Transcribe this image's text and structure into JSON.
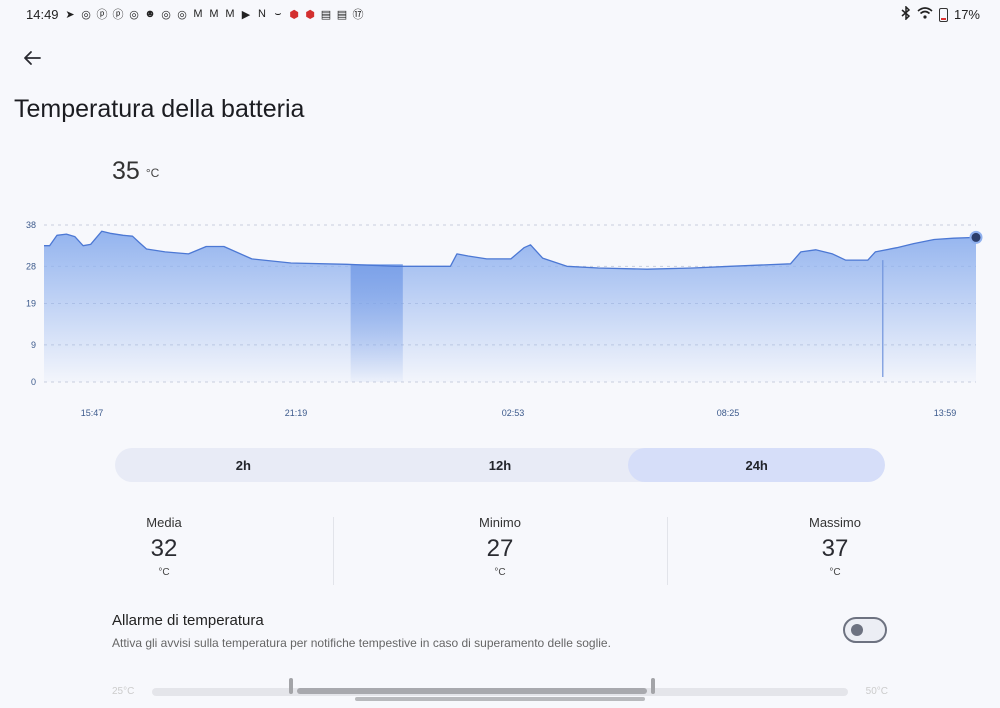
{
  "status_bar": {
    "time": "14:49",
    "battery_percent": "17%",
    "notification_icons": [
      "telegram-icon",
      "instagram-icon",
      "pinterest-icon",
      "pinterest-icon",
      "instagram-icon",
      "reddit-icon",
      "instagram-icon",
      "instagram-icon",
      "gmail-icon",
      "gmail-icon",
      "gmail-icon",
      "play-icon",
      "netflix-icon",
      "amazon-icon",
      "app-icon",
      "app-icon",
      "news-icon",
      "news-icon",
      "calendar-icon"
    ],
    "notification_glyphs": [
      "➤",
      "◎",
      "ⓟ",
      "ⓟ",
      "◎",
      "☻",
      "◎",
      "◎",
      "M",
      "M",
      "M",
      "▶",
      "N",
      "⌣",
      "⬢",
      "⬢",
      "▤",
      "▤",
      "⑰"
    ],
    "calendar_day": "17"
  },
  "header": {
    "title": "Temperatura della batteria"
  },
  "current": {
    "value": "35",
    "unit": "°C"
  },
  "chart_data": {
    "type": "area",
    "title": "",
    "xlabel": "",
    "ylabel": "",
    "y_ticks": [
      0,
      9,
      19,
      28,
      38
    ],
    "y_tick_labels": [
      "0",
      "9",
      "19",
      "28",
      "38"
    ],
    "ylim": [
      0,
      38
    ],
    "x_tick_labels": [
      "15:47",
      "21:19",
      "02:53",
      "08:25",
      "13:59"
    ],
    "grid": true,
    "accent_color": "#4c78d4",
    "fill_color": "#8eb0ee",
    "highlight_band_color": "#7aa0e8",
    "series": [
      {
        "name": "",
        "points": [
          [
            0.0,
            33.0
          ],
          [
            0.6,
            33.0
          ],
          [
            1.4,
            35.5
          ],
          [
            2.4,
            35.8
          ],
          [
            3.3,
            35.2
          ],
          [
            4.2,
            33.0
          ],
          [
            5.0,
            33.3
          ],
          [
            6.2,
            36.5
          ],
          [
            7.1,
            36.0
          ],
          [
            8.5,
            35.5
          ],
          [
            9.5,
            35.3
          ],
          [
            10.2,
            33.8
          ],
          [
            11.0,
            32.2
          ],
          [
            13.0,
            31.5
          ],
          [
            15.5,
            31.0
          ],
          [
            17.4,
            32.8
          ],
          [
            19.3,
            32.8
          ],
          [
            22.3,
            29.8
          ],
          [
            26.5,
            28.8
          ],
          [
            32.5,
            28.5
          ],
          [
            37.8,
            28.0
          ],
          [
            43.6,
            28.0
          ],
          [
            44.3,
            31.0
          ],
          [
            45.5,
            30.5
          ],
          [
            47.5,
            29.8
          ],
          [
            50.1,
            29.8
          ],
          [
            51.5,
            32.5
          ],
          [
            52.2,
            33.2
          ],
          [
            53.5,
            30.0
          ],
          [
            56.1,
            28.0
          ],
          [
            59.5,
            27.6
          ],
          [
            64.7,
            27.3
          ],
          [
            69.6,
            27.6
          ],
          [
            73.6,
            28.0
          ],
          [
            80.1,
            28.6
          ],
          [
            81.2,
            31.5
          ],
          [
            82.8,
            32.0
          ],
          [
            84.6,
            31.0
          ],
          [
            86.0,
            29.5
          ],
          [
            88.4,
            29.5
          ],
          [
            89.2,
            31.5
          ],
          [
            91.5,
            32.5
          ],
          [
            93.3,
            33.5
          ],
          [
            95.5,
            34.5
          ],
          [
            97.6,
            34.8
          ],
          [
            100.0,
            35.0
          ]
        ]
      }
    ],
    "x_domain": [
      0,
      100
    ],
    "highlight_band": [
      32.9,
      38.5
    ],
    "highlight_marker": 90.0,
    "end_marker": [
      100.0,
      35.0
    ]
  },
  "range_selector": {
    "options": [
      "2h",
      "12h",
      "24h"
    ],
    "selected": "24h"
  },
  "stats": [
    {
      "label": "Media",
      "value": "32",
      "unit": "°C"
    },
    {
      "label": "Minimo",
      "value": "27",
      "unit": "°C"
    },
    {
      "label": "Massimo",
      "value": "37",
      "unit": "°C"
    }
  ],
  "alarm": {
    "title": "Allarme di temperatura",
    "description": "Attiva gli avvisi sulla temperatura per notifiche tempestive in caso di superamento delle soglie.",
    "enabled": false
  },
  "threshold_slider": {
    "min_label": "25°C",
    "max_label": "50°C",
    "low_fraction": 0.2,
    "high_fraction": 0.72
  }
}
